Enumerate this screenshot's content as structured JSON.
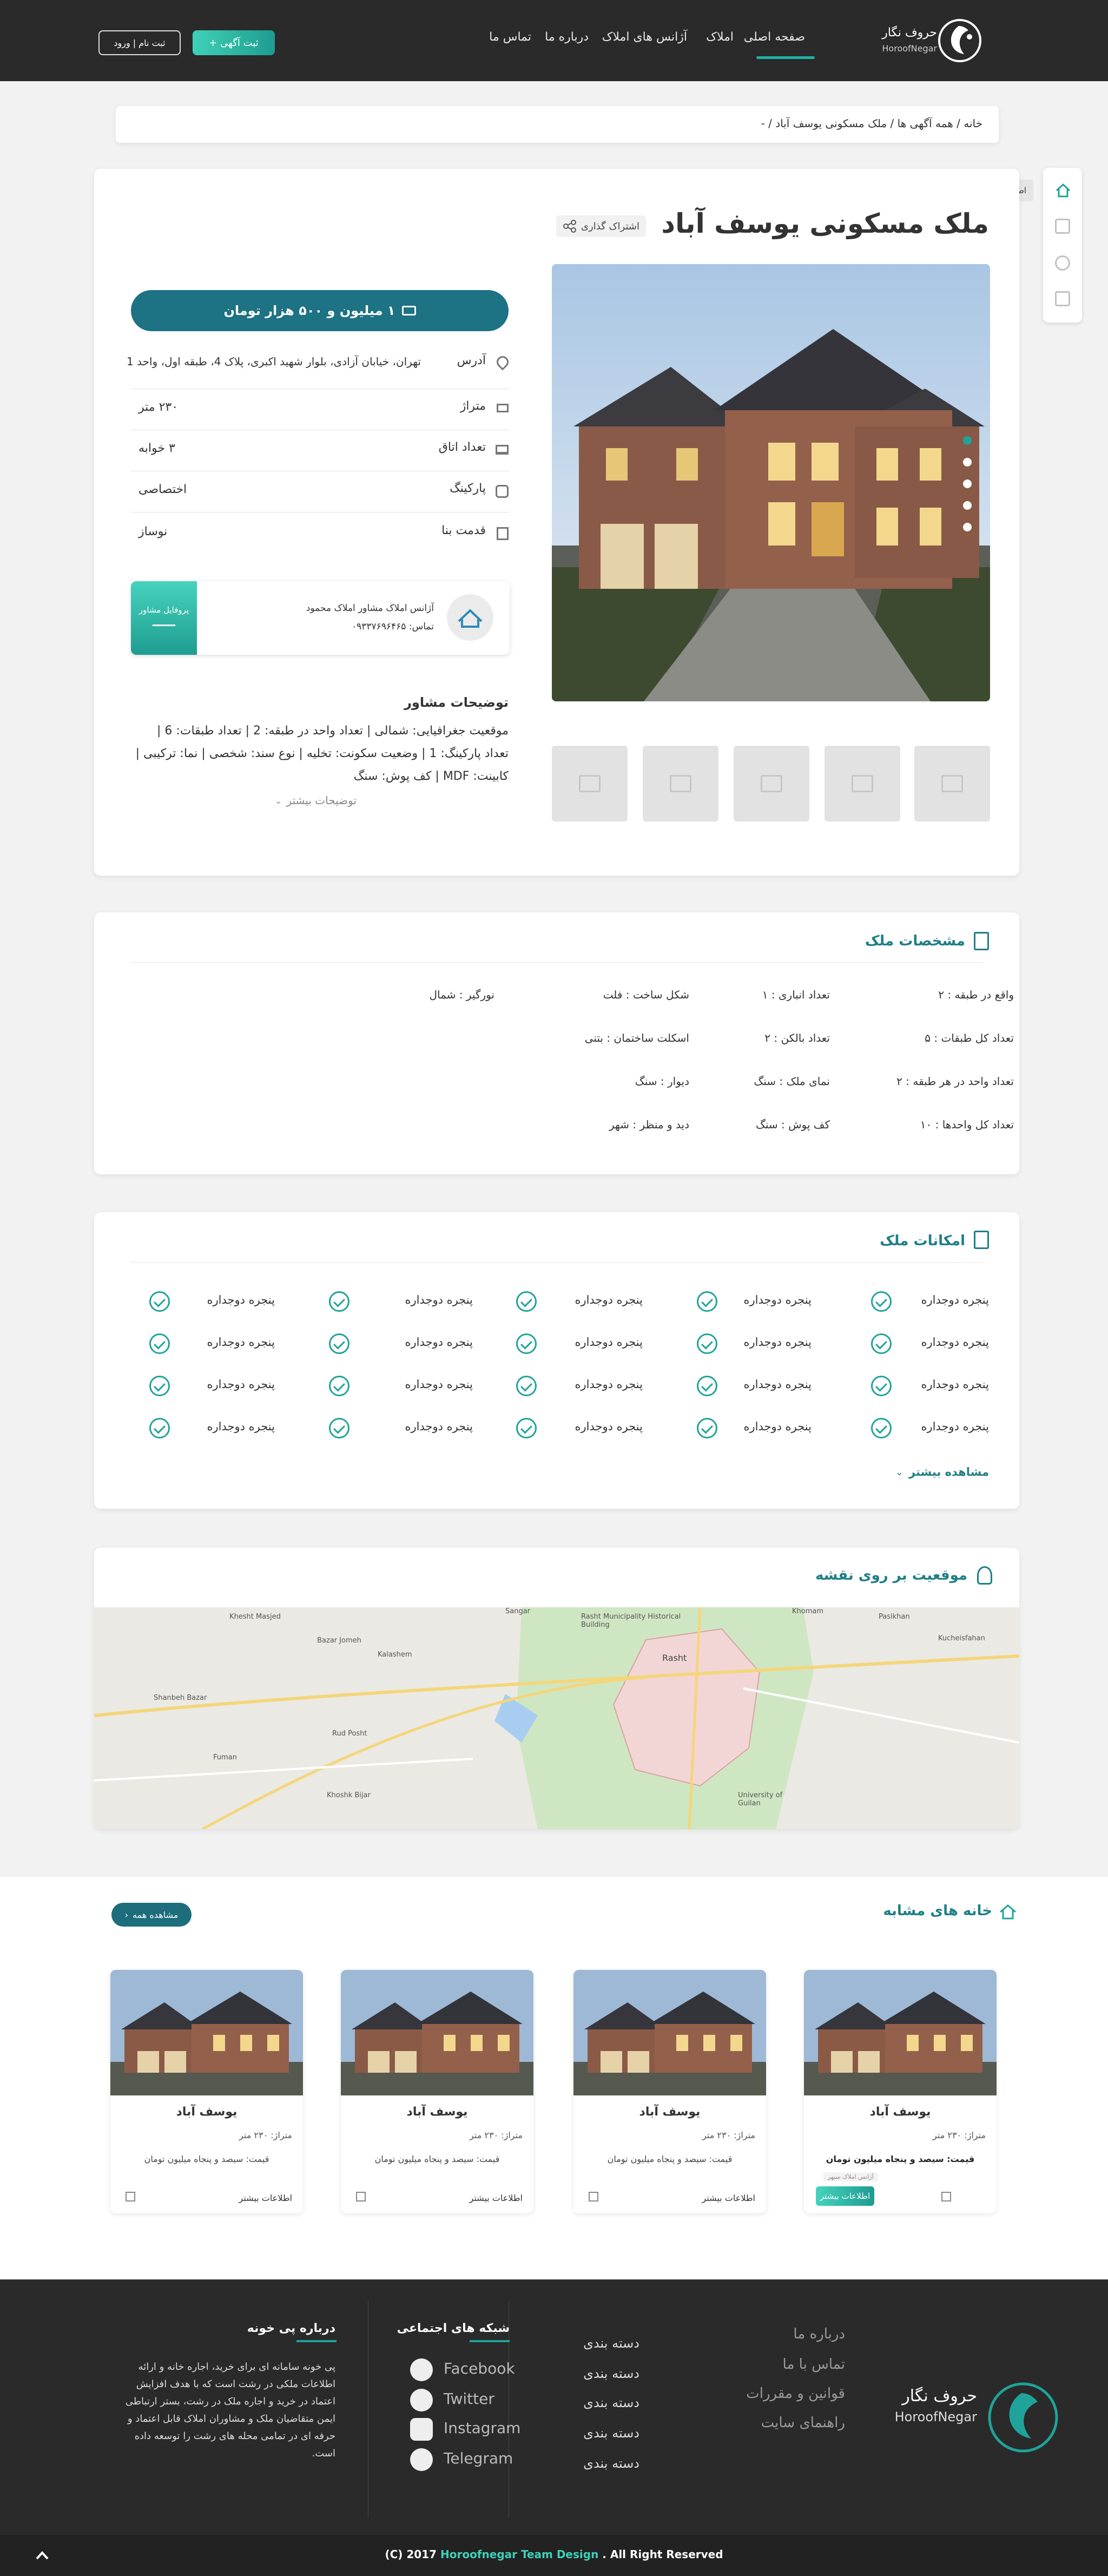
{
  "header": {
    "brand": "حروف نگار",
    "brand_en": "HoroofNegar",
    "nav": [
      "صفحه اصلی",
      "املاک",
      "آژانس های املاک",
      "درباره ما",
      "تماس ما"
    ],
    "post_button": "ثبت آگهی +",
    "login_button": "ثبت نام | ورود"
  },
  "breadcrumb": "خانه / همه آگهی ها / ملک مسکونی یوسف آباد / -",
  "sidebar": {
    "tooltip": "اطلاعات کلی",
    "icons": [
      "home-icon",
      "document-icon",
      "user-location-icon",
      "building-icon"
    ]
  },
  "listing": {
    "title": "ملک مسکونی یوسف آباد",
    "share": "اشتراک گذاری",
    "price": "۱ میلیون و ۵۰۰ هزار تومان",
    "info": [
      {
        "label": "آدرس",
        "value": "تهران، خیابان آزادی، بلوار شهید اکبری، پلاک 4، طبقه اول، واحد 1"
      },
      {
        "label": "متراژ",
        "value": "۲۳۰ متر"
      },
      {
        "label": "تعداد اتاق",
        "value": "۳ خوابه"
      },
      {
        "label": "پارکینگ",
        "value": "اختصاصی"
      },
      {
        "label": "قدمت بنا",
        "value": "نوساز"
      }
    ],
    "agent": {
      "name": "آژانس املاک مشاور املاک محمود",
      "phone": "تماس: ۰۹۳۳۷۶۹۶۴۶۵",
      "profile_button": "پروفایل مشاور"
    },
    "advisor_title": "توضیحات مشاور",
    "advisor_text": "موقعیت جغرافیایی: شمالی | تعداد واحد در طبقه: 2 | تعداد طبقات: 6 | تعداد پارکینگ: 1 | وضعیت سکونت: تخلیه | نوع سند: شخصی | نما: ترکیبی | کابینت: MDF | کف پوش: سنگ",
    "more_desc": "توضیحات بیشتر"
  },
  "specs": {
    "title": "مشخصات ملک",
    "rows": [
      [
        "واقع در طبقه : ۲",
        "تعداد انباری : ۱",
        "شکل ساخت : فلت",
        "نورگیر : شمال"
      ],
      [
        "تعداد کل طبقات : ۵",
        "تعداد بالکن : ۲",
        "اسکلت ساختمان : بتنی",
        ""
      ],
      [
        "تعداد واحد در هر طبقه : ۲",
        "نمای ملک : سنگ",
        "دیوار : سنگ",
        ""
      ],
      [
        "تعداد کل واحدها : ۱۰",
        "کف پوش : سنگ",
        "دید و منظر : شهر",
        ""
      ]
    ]
  },
  "features": {
    "title": "امکانات ملک",
    "item": "پنجره دوجداره",
    "rows": 4,
    "cols": 5,
    "more": "مشاهده بیشتر"
  },
  "map": {
    "title": "موقعیت بر روی نقشه",
    "labels": [
      "Rasht",
      "Rasht Municipality Historical Building",
      "Kucheisfahan",
      "Sangar",
      "Khomam",
      "Bazar Jomeh",
      "Kalashem",
      "Rud Posht",
      "Shanbeh Bazar",
      "Fuman",
      "Khoshk Bijar",
      "Pasikhan",
      "Khesht Masjed",
      "University of Guilan"
    ]
  },
  "similar": {
    "title": "خانه های مشابه",
    "view_all": "مشاهده همه",
    "cards": [
      {
        "name": "یوسف آباد",
        "area": "متراژ: ۲۳۰ متر",
        "price": "قیمت: سیصد و پنجاه میلیون تومان",
        "more": "اطلاعات بیشتر",
        "tag": "آژانس املاک سپهر"
      },
      {
        "name": "یوسف آباد",
        "area": "متراژ: ۲۳۰ متر",
        "price": "قیمت: سیصد و پنجاه میلیون تومان",
        "more": "اطلاعات بیشتر"
      },
      {
        "name": "یوسف آباد",
        "area": "متراژ: ۲۳۰ متر",
        "price": "قیمت: سیصد و پنجاه میلیون تومان",
        "more": "اطلاعات بیشتر"
      },
      {
        "name": "یوسف آباد",
        "area": "متراژ: ۲۳۰ متر",
        "price": "قیمت: سیصد و پنجاه میلیون تومان",
        "more": "اطلاعات بیشتر"
      }
    ]
  },
  "footer": {
    "brand": "حروف نگار",
    "brand_en": "HoroofNegar",
    "links": [
      "درباره ما",
      "تماس با ما",
      "قوانین و مقررات",
      "راهنمای سایت"
    ],
    "categories": [
      "دسته بندی",
      "دسته بندی",
      "دسته بندی",
      "دسته بندی",
      "دسته بندی"
    ],
    "social_title": "شبکه های اجتماعی",
    "social": [
      "Facebook",
      "Twitter",
      "Instagram",
      "Telegram"
    ],
    "about_title": "درباره پی خونه",
    "about_text": "پی خونه سامانه ای برای خرید، اجاره خانه و ارائه اطلاعات ملکی در رشت است که با هدف افزایش اعتماد در خرید و اجاره ملک در رشت، بستر ارتباطی ایمن متقاضیان ملک و مشاوران املاک قابل اعتماد و حرفه ای در تمامی محله های رشت را توسعه داده است.",
    "copyright_pre": "(C) 2017",
    "copyright_team": "Horoofnegar Team Design",
    "copyright_post": ". All Right Reserved"
  },
  "colors": {
    "accent": "#1f7f86",
    "teal_light": "#3fd1b8",
    "header_bg": "#2a2a2a"
  }
}
